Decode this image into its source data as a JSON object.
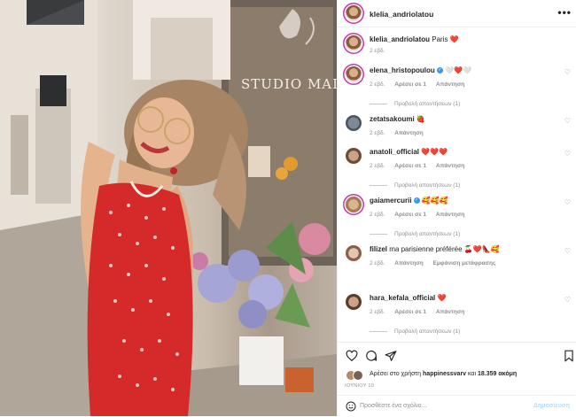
{
  "post": {
    "owner": "klelia_andriolatou",
    "caption_user": "klelia_andriolatou",
    "caption_text": "Paris ❤️",
    "caption_time": "2 εβδ.",
    "photo_sign": "STUDIO MAISON"
  },
  "comments": [
    {
      "user": "elena_hristopoulou",
      "verified": true,
      "text": "🤍❤️🤍",
      "time": "2 εβδ.",
      "likes": "Αρέσει σε 1",
      "reply": "Απάντηση",
      "view_replies": "Προβολή απαντήσεων (1)"
    },
    {
      "user": "zetatsakoumi",
      "verified": false,
      "text": "🍓",
      "time": "2 εβδ.",
      "likes": "",
      "reply": "Απάντηση",
      "view_replies": ""
    },
    {
      "user": "anatoli_official",
      "verified": false,
      "text": "❤️❤️❤️",
      "time": "2 εβδ.",
      "likes": "Αρέσει σε 1",
      "reply": "Απάντηση",
      "view_replies": "Προβολή απαντήσεων (1)"
    },
    {
      "user": "gaiamercurii",
      "verified": true,
      "text": "🥰🥰🥰",
      "time": "2 εβδ.",
      "likes": "Αρέσει σε 1",
      "reply": "Απάντηση",
      "view_replies": "Προβολή απαντήσεων (1)"
    },
    {
      "user": "filizel",
      "verified": false,
      "text": "ma parisienne préférée 🍒❤️👠🥰",
      "time": "2 εβδ.",
      "likes": "",
      "reply": "Απάντηση",
      "translate": "Εμφάνιση μετάφρασης",
      "view_replies": ""
    },
    {
      "user": "hara_kefala_official",
      "verified": false,
      "text": "❤️",
      "time": "2 εβδ.",
      "likes": "Αρέσει σε 1",
      "reply": "Απάντηση",
      "view_replies": "Προβολή απαντήσεων (1)"
    }
  ],
  "likes_line": {
    "prefix": "Αρέσει στο χρήστη",
    "user": "happinessvarv",
    "middle": "και",
    "count": "18.359 ακόμη"
  },
  "date": "ΙΟΥΝΙΟΥ 10",
  "add_comment": {
    "placeholder": "Προσθέστε ένα σχόλιο...",
    "post_label": "Δημοσίευση"
  },
  "icons": {
    "more": "more-options-icon",
    "like": "heart-icon",
    "comment": "comment-icon",
    "share": "paper-plane-icon",
    "save": "bookmark-icon",
    "emoji": "smiley-icon"
  },
  "colors": {
    "accent": "#c837ab",
    "verified": "#3897f0",
    "like_red": "#ed4956",
    "post_disabled": "#b3dbff"
  }
}
